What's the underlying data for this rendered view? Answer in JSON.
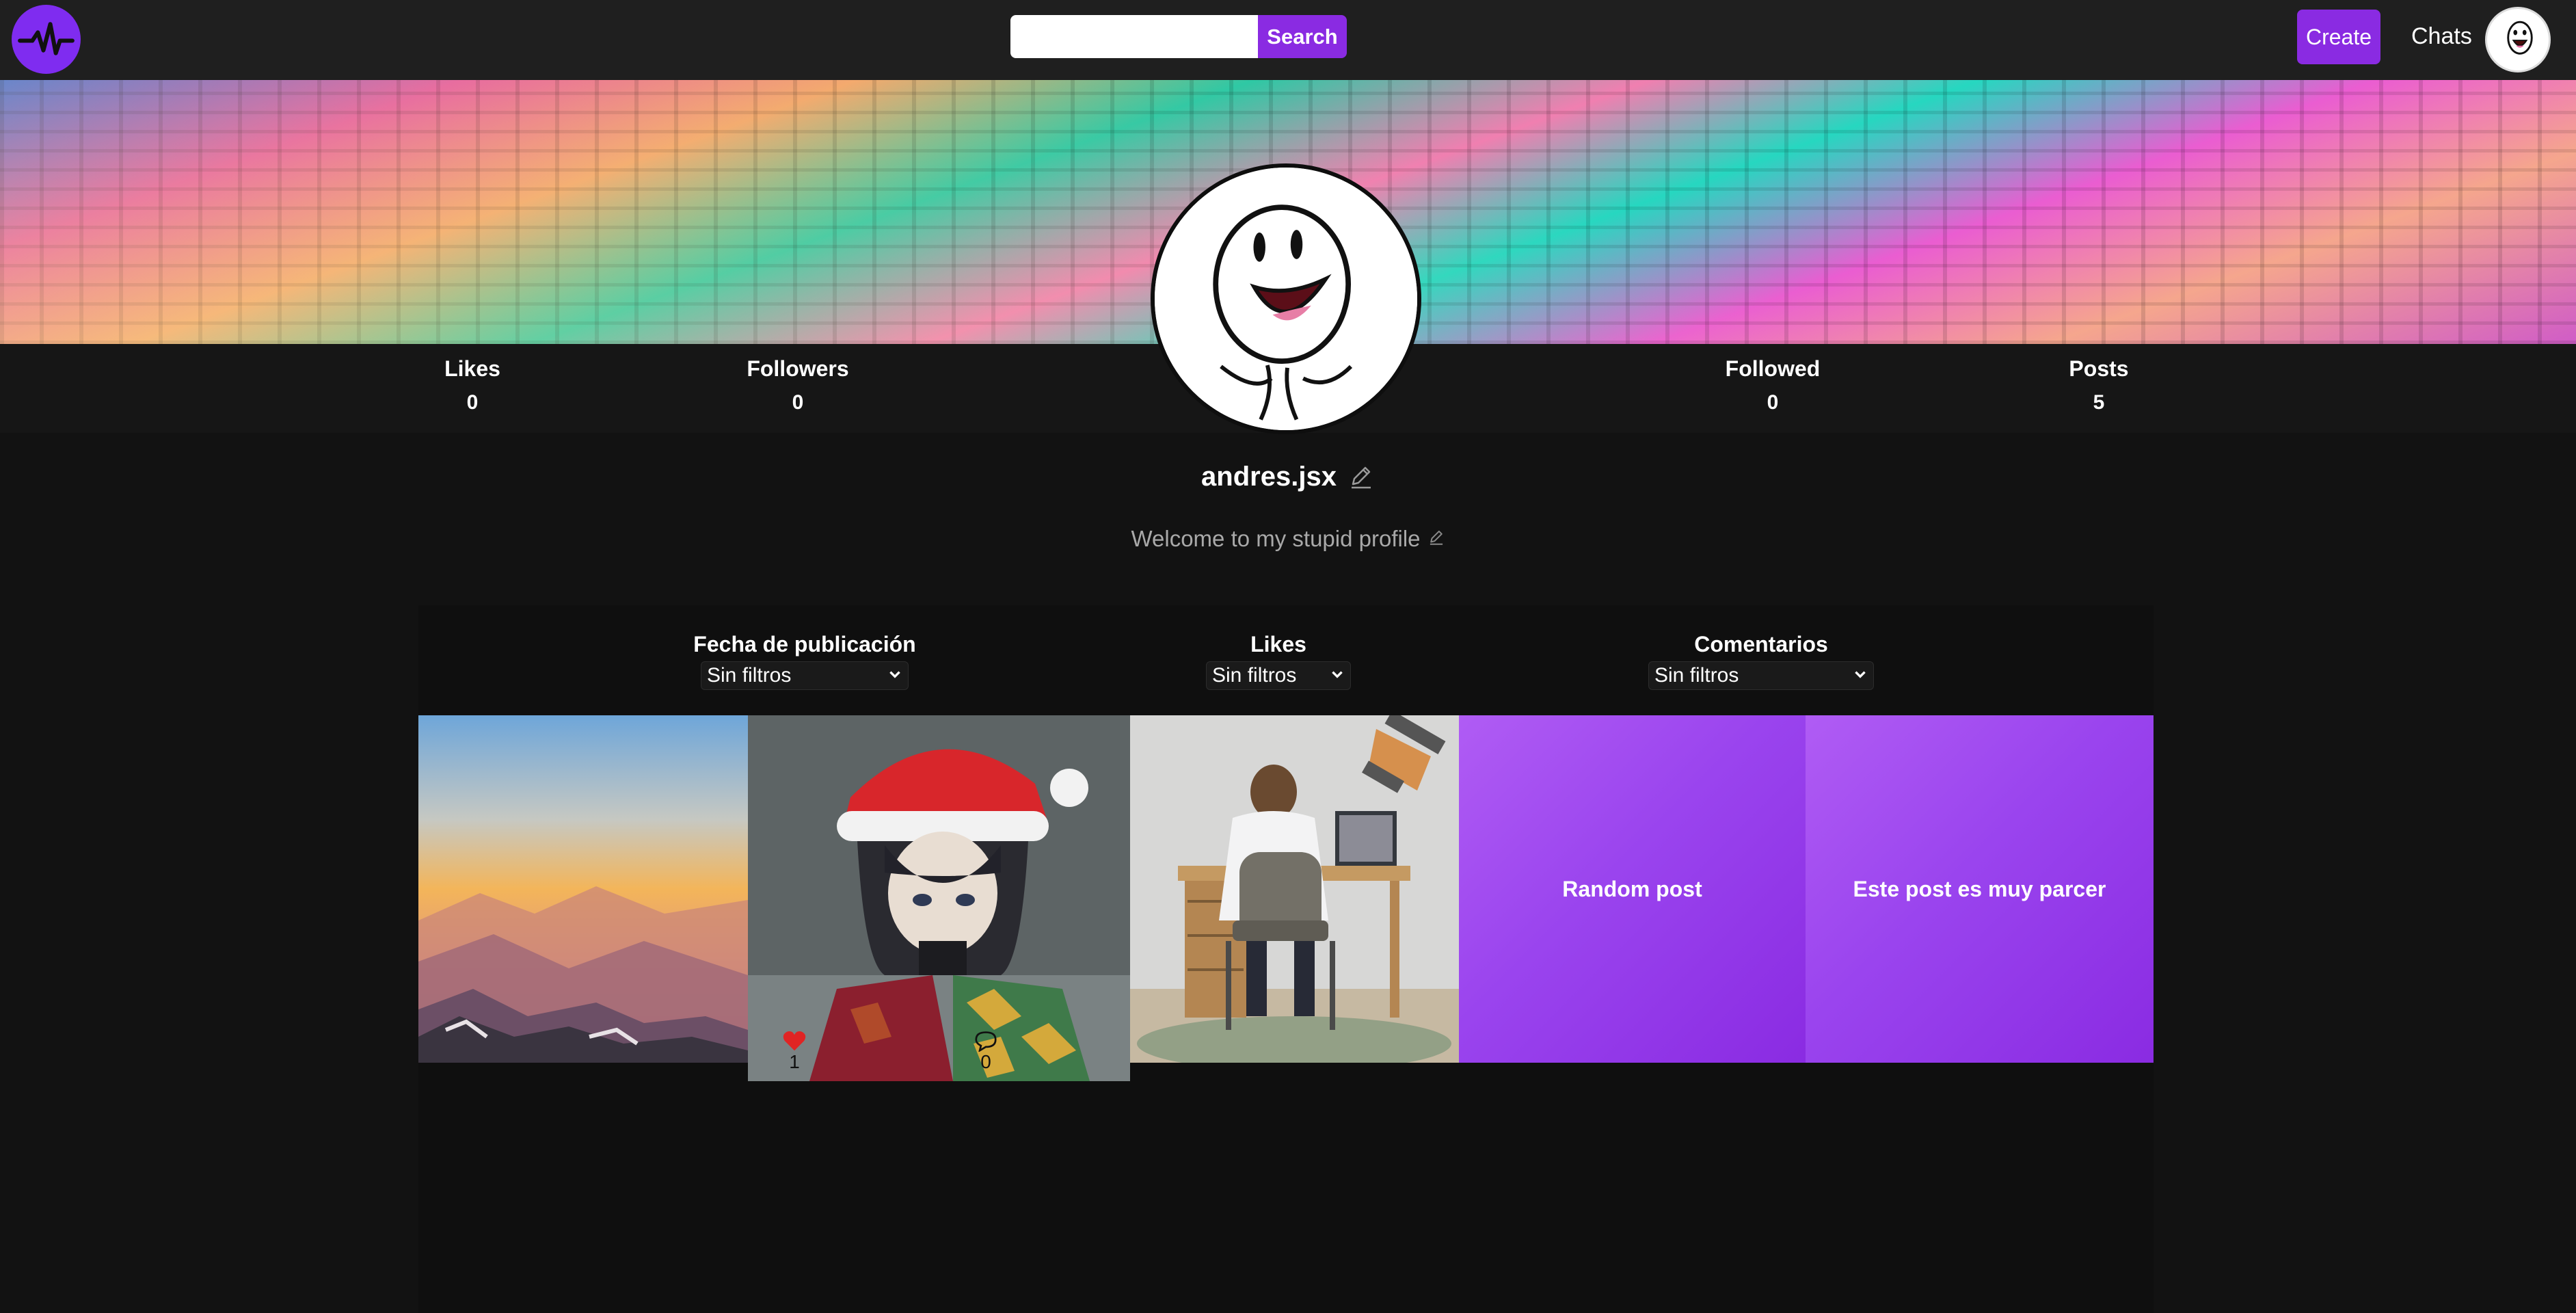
{
  "navbar": {
    "search_placeholder": "",
    "search_label": "Search",
    "create_label": "Create",
    "chats_label": "Chats"
  },
  "stats": {
    "likes": {
      "label": "Likes",
      "value": "0"
    },
    "followers": {
      "label": "Followers",
      "value": "0"
    },
    "followed": {
      "label": "Followed",
      "value": "0"
    },
    "posts": {
      "label": "Posts",
      "value": "5"
    }
  },
  "profile": {
    "username": "andres.jsx",
    "bio": "Welcome to my stupid profile"
  },
  "filters": {
    "date": {
      "label": "Fecha de publicación",
      "selected": "Sin filtros"
    },
    "likes": {
      "label": "Likes",
      "selected": "Sin filtros"
    },
    "comments": {
      "label": "Comentarios",
      "selected": "Sin filtros"
    }
  },
  "posts": [
    {
      "type": "image",
      "subject": "mountain sunset"
    },
    {
      "type": "image",
      "subject": "anime character with santa hat",
      "likes": "1",
      "comments": "0"
    },
    {
      "type": "image",
      "subject": "man at desk with cat"
    },
    {
      "type": "text",
      "text": "Random post"
    },
    {
      "type": "text",
      "text": "Este post es muy parcer"
    }
  ],
  "colors": {
    "accent": "#8a2be2",
    "background": "#121212",
    "navbar": "#1f1f1f",
    "heart": "#e02424"
  },
  "icons": {
    "logo": "pulse-icon",
    "edit": "pencil-icon",
    "like": "heart-icon",
    "comment": "speech-bubble-icon",
    "dropdown": "chevron-down-icon"
  }
}
